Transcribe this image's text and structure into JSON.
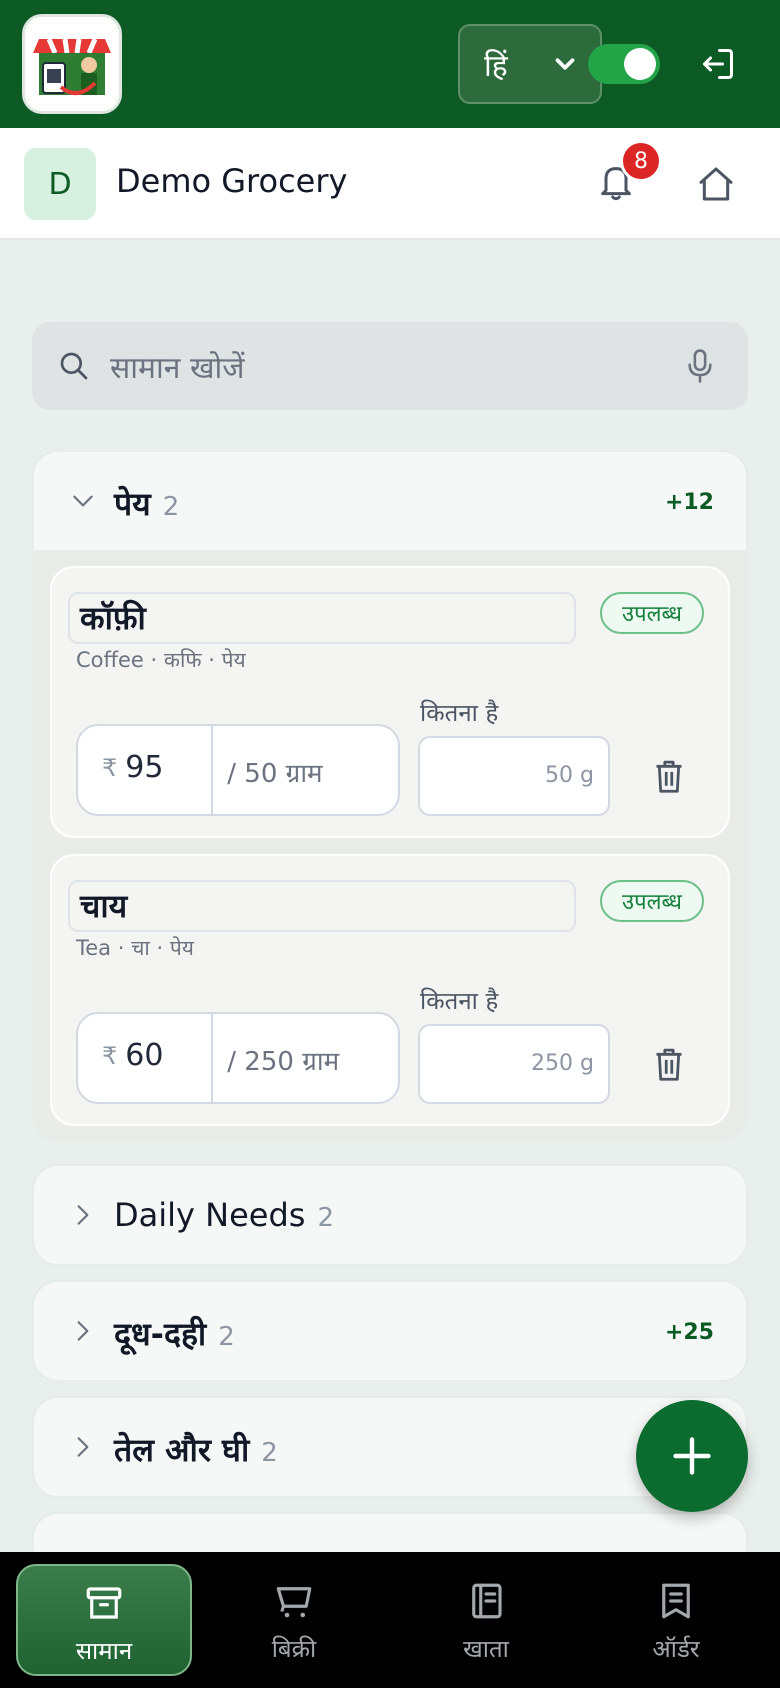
{
  "topbar": {
    "language_label": "हिं",
    "toggle_on": true
  },
  "header": {
    "avatar_letter": "D",
    "store_name": "Demo Grocery",
    "notification_count": "8"
  },
  "search": {
    "placeholder": "सामान खोजें"
  },
  "categories": [
    {
      "title": "पेय",
      "count": "2",
      "extra": "+12",
      "expanded": true,
      "items": [
        {
          "name": "कॉफ़ी",
          "status": "उपलब्ध",
          "aliases": "Coffee · कफि · पेय",
          "currency": "₹",
          "price": "95",
          "unit": "/ 50 ग्राम",
          "qty_label": "कितना है",
          "qty_placeholder": "50 g"
        },
        {
          "name": "चाय",
          "status": "उपलब्ध",
          "aliases": "Tea · चा · पेय",
          "currency": "₹",
          "price": "60",
          "unit": "/ 250 ग्राम",
          "qty_label": "कितना है",
          "qty_placeholder": "250 g"
        }
      ]
    },
    {
      "title": "Daily Needs",
      "count": "2",
      "extra": ""
    },
    {
      "title": "दूध-दही",
      "count": "2",
      "extra": "+25"
    },
    {
      "title": "तेल और घी",
      "count": "2",
      "extra": ""
    }
  ],
  "bottom_nav": [
    {
      "label": "सामान",
      "icon": "box-icon",
      "active": true
    },
    {
      "label": "बिक्री",
      "icon": "cart-icon",
      "active": false
    },
    {
      "label": "खाता",
      "icon": "ledger-icon",
      "active": false
    },
    {
      "label": "ऑर्डर",
      "icon": "receipt-icon",
      "active": false
    }
  ],
  "colors": {
    "brand_green": "#0c5a24",
    "available_green": "#15803d",
    "badge_red": "#dc2626"
  }
}
